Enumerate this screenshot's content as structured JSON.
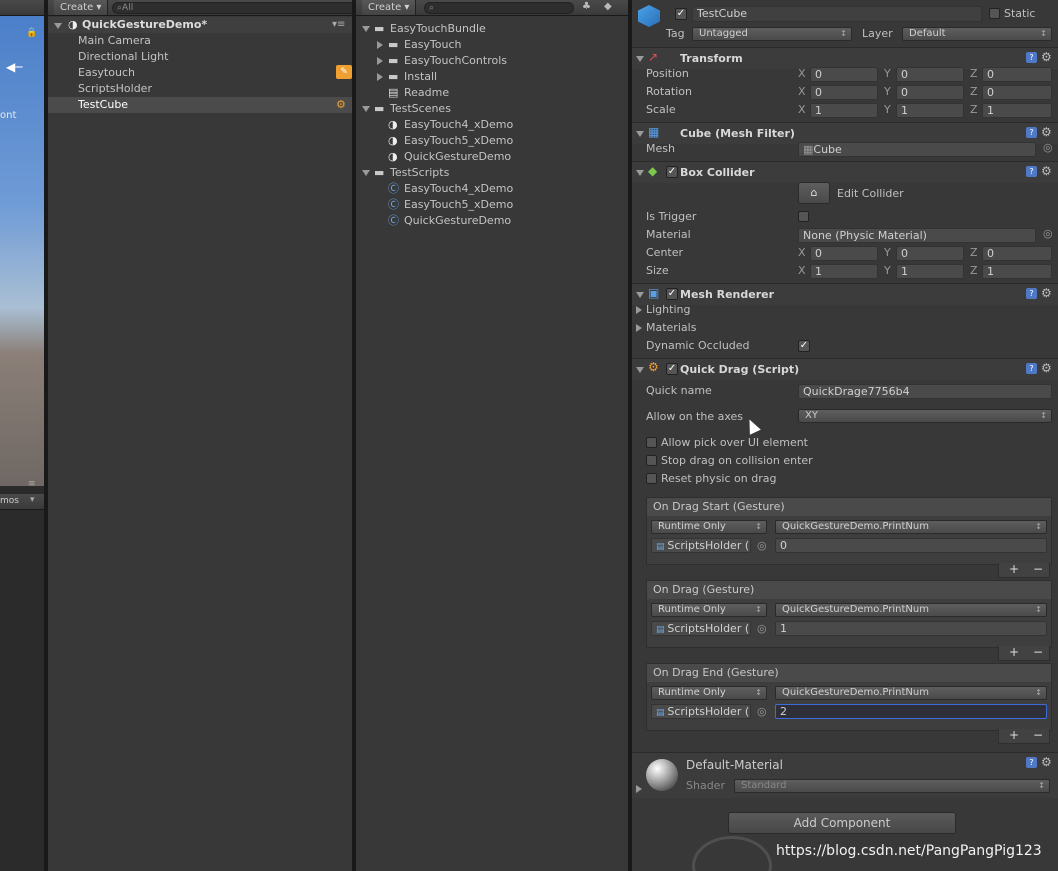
{
  "toolbars": {
    "hierarchy_create": "Create",
    "hierarchy_search": "All",
    "project_create": "Create"
  },
  "scene": {
    "side_text": "ont",
    "gizmos": "mos"
  },
  "hierarchy": {
    "scene_name": "QuickGestureDemo*",
    "items": [
      "Main Camera",
      "Directional Light",
      "Easytouch",
      "ScriptsHolder",
      "TestCube"
    ]
  },
  "project": {
    "items": [
      {
        "label": "EasyTouchBundle",
        "kind": "folder"
      },
      {
        "label": "EasyTouch",
        "kind": "folder"
      },
      {
        "label": "EasyTouchControls",
        "kind": "folder"
      },
      {
        "label": "Install",
        "kind": "folder"
      },
      {
        "label": "Readme",
        "kind": "doc"
      },
      {
        "label": "TestScenes",
        "kind": "folder"
      },
      {
        "label": "EasyTouch4_xDemo",
        "kind": "scene"
      },
      {
        "label": "EasyTouch5_xDemo",
        "kind": "scene"
      },
      {
        "label": "QuickGestureDemo",
        "kind": "scene"
      },
      {
        "label": "TestScripts",
        "kind": "folder"
      },
      {
        "label": "EasyTouch4_xDemo",
        "kind": "script"
      },
      {
        "label": "EasyTouch5_xDemo",
        "kind": "script"
      },
      {
        "label": "QuickGestureDemo",
        "kind": "script"
      }
    ]
  },
  "inspector": {
    "object_name": "TestCube",
    "static_label": "Static",
    "tag_label": "Tag",
    "tag_value": "Untagged",
    "layer_label": "Layer",
    "layer_value": "Default",
    "transform": {
      "title": "Transform",
      "position_label": "Position",
      "rotation_label": "Rotation",
      "scale_label": "Scale",
      "x": "X",
      "y": "Y",
      "z": "Z",
      "position": [
        "0",
        "0",
        "0"
      ],
      "rotation": [
        "0",
        "0",
        "0"
      ],
      "scale": [
        "1",
        "1",
        "1"
      ]
    },
    "mesh_filter": {
      "title": "Cube (Mesh Filter)",
      "mesh_label": "Mesh",
      "mesh_value": "Cube"
    },
    "box_collider": {
      "title": "Box Collider",
      "edit_label": "Edit Collider",
      "trigger_label": "Is Trigger",
      "material_label": "Material",
      "material_value": "None (Physic Material)",
      "center_label": "Center",
      "size_label": "Size",
      "center": [
        "0",
        "0",
        "0"
      ],
      "size": [
        "1",
        "1",
        "1"
      ]
    },
    "mesh_renderer": {
      "title": "Mesh Renderer",
      "lighting": "Lighting",
      "materials": "Materials",
      "occluded_label": "Dynamic Occluded"
    },
    "quick_drag": {
      "title": "Quick Drag (Script)",
      "name_label": "Quick name",
      "name_value": "QuickDrage7756b4",
      "axes_label": "Allow on the axes",
      "axes_value": "XY",
      "pick_label": "Allow pick over UI element",
      "stop_label": "Stop drag on collision enter",
      "reset_label": "Reset physic on drag",
      "events": [
        {
          "title": "On Drag Start (Gesture)",
          "mode": "Runtime Only",
          "function": "QuickGestureDemo.PrintNum",
          "object": "ScriptsHolder (",
          "arg": "0"
        },
        {
          "title": "On Drag (Gesture)",
          "mode": "Runtime Only",
          "function": "QuickGestureDemo.PrintNum",
          "object": "ScriptsHolder (",
          "arg": "1"
        },
        {
          "title": "On Drag End (Gesture)",
          "mode": "Runtime Only",
          "function": "QuickGestureDemo.PrintNum",
          "object": "ScriptsHolder (",
          "arg": "2"
        }
      ]
    },
    "material": {
      "name": "Default-Material",
      "shader_label": "Shader",
      "shader_value": "Standard"
    },
    "add_component": "Add Component"
  },
  "watermark": "https://blog.csdn.net/PangPangPig123"
}
